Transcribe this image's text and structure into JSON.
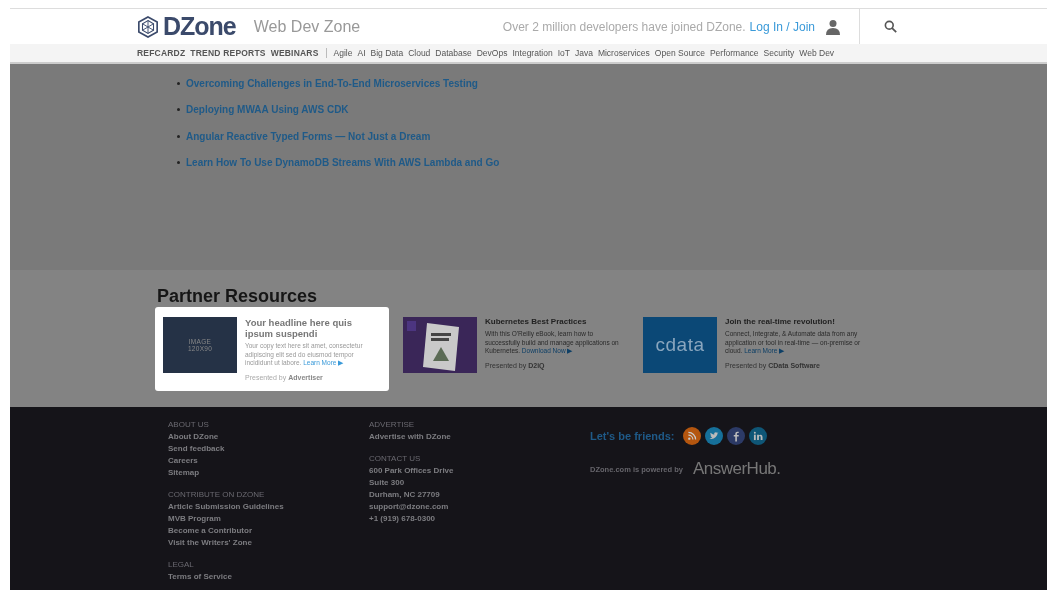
{
  "header": {
    "brand": "DZone",
    "zone": "Web Dev Zone",
    "tagline": "Over 2 million developers have joined DZone.",
    "login": "Log In / Join"
  },
  "nav": {
    "primary": [
      "REFCARDZ",
      "TREND REPORTS",
      "WEBINARS"
    ],
    "topics": [
      "Agile",
      "AI",
      "Big Data",
      "Cloud",
      "Database",
      "DevOps",
      "Integration",
      "IoT",
      "Java",
      "Microservices",
      "Open Source",
      "Performance",
      "Security",
      "Web Dev"
    ]
  },
  "articles": [
    "Overcoming Challenges in End-To-End Microservices Testing",
    "Deploying MWAA Using AWS CDK",
    "Angular Reactive Typed Forms — Not Just a Dream",
    "Learn How To Use DynamoDB Streams With AWS Lambda and Go"
  ],
  "partner_resources": {
    "title": "Partner Resources",
    "cards": [
      {
        "kind": "placeholder",
        "highlighted": true,
        "image_lines": [
          "IMAGE",
          "120X90"
        ],
        "headline": "Your headline here quis ipsum suspendi",
        "body": "Your copy text here sit amet, consectetur adipiscing elit sed do eiusmod tempor incididunt ut labore.",
        "link": "Learn More ▶",
        "presented_by": "Presented by",
        "presenter": "Advertiser"
      },
      {
        "kind": "book",
        "highlighted": false,
        "headline": "Kubernetes Best Practices",
        "body": "With this O'Reilly eBook, learn how to successfully build and manage applications on Kubernetes.",
        "link": "Download Now ▶",
        "presented_by": "Presented by",
        "presenter": "D2iQ"
      },
      {
        "kind": "logo",
        "highlighted": false,
        "logo": "cdata",
        "headline": "Join the real-time revolution!",
        "body": "Connect, Integrate, & Automate data from any application or tool in real-time — on-premise or cloud.",
        "link": "Learn More ▶",
        "presented_by": "Presented by",
        "presenter": "CData Software"
      }
    ]
  },
  "footer": {
    "columns": [
      [
        {
          "heading": "ABOUT US",
          "items": [
            "About DZone",
            "Send feedback",
            "Careers",
            "Sitemap"
          ]
        },
        {
          "heading": "CONTRIBUTE ON DZONE",
          "items": [
            "Article Submission Guidelines",
            "MVB Program",
            "Become a Contributor",
            "Visit the Writers' Zone"
          ]
        },
        {
          "heading": "LEGAL",
          "items": [
            "Terms of Service"
          ]
        }
      ],
      [
        {
          "heading": "ADVERTISE",
          "items": [
            "Advertise with DZone"
          ]
        },
        {
          "heading": "CONTACT US",
          "items": [
            "600 Park Offices Drive",
            "Suite 300",
            "Durham, NC 27709",
            "support@dzone.com",
            "+1 (919) 678-0300"
          ]
        }
      ]
    ],
    "social": {
      "label": "Let's be friends:",
      "icons": [
        {
          "kind": "rss"
        },
        {
          "kind": "twitter"
        },
        {
          "kind": "facebook"
        },
        {
          "kind": "linkedin"
        }
      ]
    },
    "powered_by": "DZone.com is powered by",
    "powered_logo": "AnswerHub."
  }
}
